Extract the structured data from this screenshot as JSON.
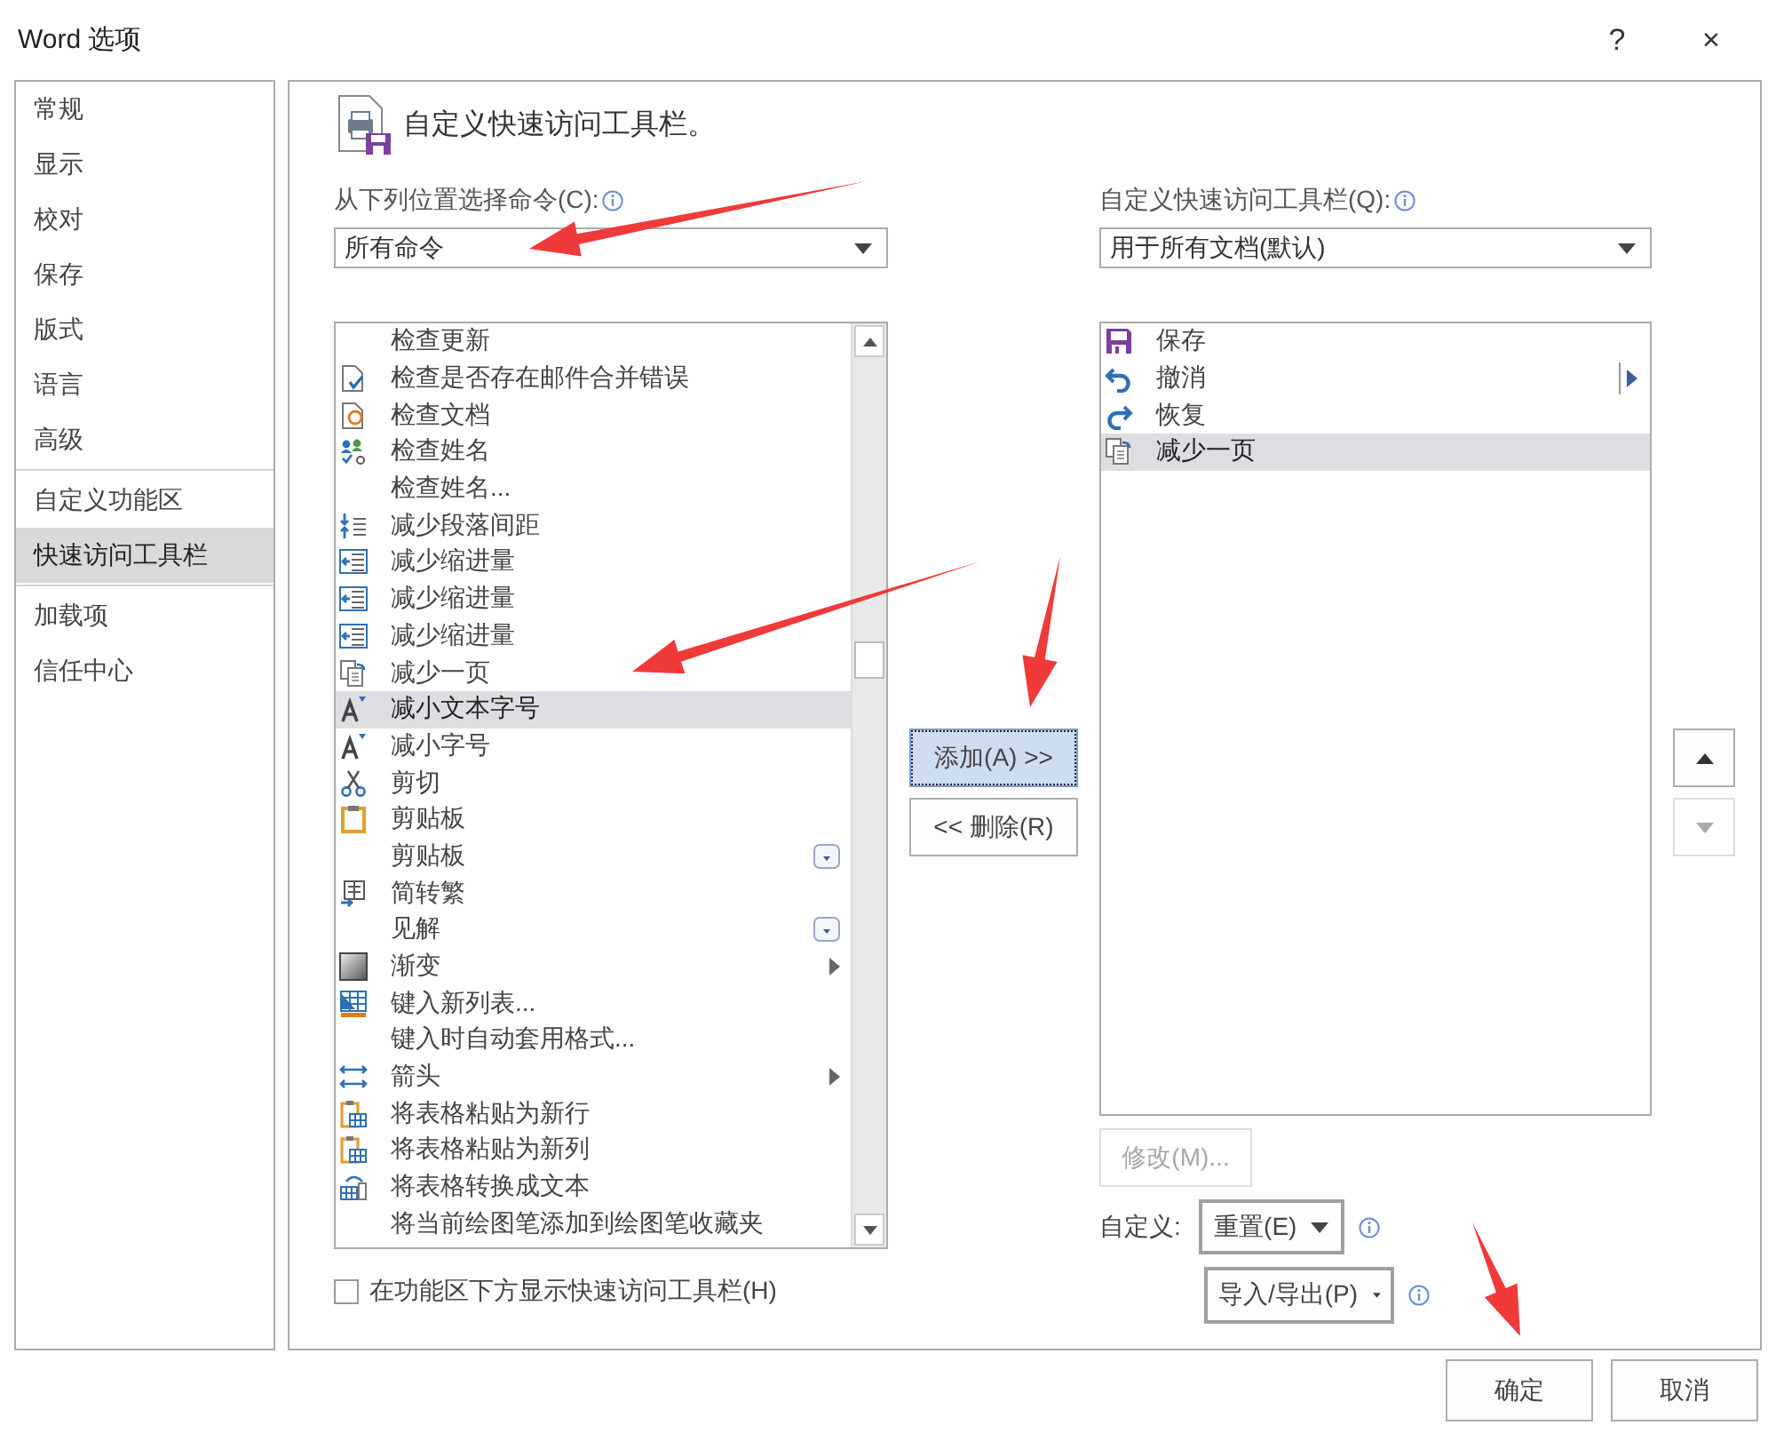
{
  "window": {
    "title": "Word 选项",
    "help": "?",
    "close": "×"
  },
  "sidebar": {
    "groups": [
      {
        "items": [
          {
            "label": "常规",
            "selected": false
          },
          {
            "label": "显示",
            "selected": false
          },
          {
            "label": "校对",
            "selected": false
          },
          {
            "label": "保存",
            "selected": false
          },
          {
            "label": "版式",
            "selected": false
          },
          {
            "label": "语言",
            "selected": false
          },
          {
            "label": "高级",
            "selected": false
          }
        ]
      },
      {
        "items": [
          {
            "label": "自定义功能区",
            "selected": false
          },
          {
            "label": "快速访问工具栏",
            "selected": true
          }
        ]
      },
      {
        "items": [
          {
            "label": "加载项",
            "selected": false
          },
          {
            "label": "信任中心",
            "selected": false
          }
        ]
      }
    ]
  },
  "panel": {
    "heading": "自定义快速访问工具栏。",
    "source": {
      "label": "从下列位置选择命令(C):",
      "value": "所有命令"
    },
    "commands": [
      {
        "label": "检查更新",
        "kind": "plain",
        "selected": false
      },
      {
        "label": "检查是否存在邮件合并错误",
        "kind": "plain",
        "selected": false
      },
      {
        "label": "检查文档",
        "kind": "plain",
        "selected": false
      },
      {
        "label": "检查姓名",
        "kind": "plain",
        "selected": false
      },
      {
        "label": "检查姓名...",
        "kind": "plain",
        "selected": false
      },
      {
        "label": "减少段落间距",
        "kind": "plain",
        "selected": false
      },
      {
        "label": "减少缩进量",
        "kind": "plain",
        "selected": false
      },
      {
        "label": "减少缩进量",
        "kind": "plain",
        "selected": false
      },
      {
        "label": "减少缩进量",
        "kind": "plain",
        "selected": false
      },
      {
        "label": "减少一页",
        "kind": "plain",
        "selected": false
      },
      {
        "label": "减小文本字号",
        "kind": "plain",
        "selected": true
      },
      {
        "label": "减小字号",
        "kind": "plain",
        "selected": false
      },
      {
        "label": "剪切",
        "kind": "plain",
        "selected": false
      },
      {
        "label": "剪贴板",
        "kind": "plain",
        "selected": false
      },
      {
        "label": "剪贴板",
        "kind": "gallery",
        "selected": false
      },
      {
        "label": "简转繁",
        "kind": "plain",
        "selected": false
      },
      {
        "label": "见解",
        "kind": "gallery",
        "selected": false
      },
      {
        "label": "渐变",
        "kind": "submenu",
        "selected": false
      },
      {
        "label": "键入新列表...",
        "kind": "plain",
        "selected": false
      },
      {
        "label": "键入时自动套用格式...",
        "kind": "plain",
        "selected": false
      },
      {
        "label": "箭头",
        "kind": "submenu",
        "selected": false
      },
      {
        "label": "将表格粘贴为新行",
        "kind": "plain",
        "selected": false
      },
      {
        "label": "将表格粘贴为新列",
        "kind": "plain",
        "selected": false
      },
      {
        "label": "将表格转换成文本",
        "kind": "plain",
        "selected": false
      },
      {
        "label": "将当前绘图笔添加到绘图笔收藏夹",
        "kind": "plain",
        "selected": false
      }
    ],
    "show_below": {
      "label": "在功能区下方显示快速访问工具栏(H)",
      "checked": false
    },
    "add_button": {
      "label": "添加(A) >>",
      "focused": true
    },
    "remove_button": {
      "label": "<< 删除(R)",
      "focused": false
    },
    "target": {
      "label": "自定义快速访问工具栏(Q):",
      "value": "用于所有文档(默认)"
    },
    "toolbar_items": [
      {
        "label": "保存",
        "kind": "plain",
        "selected": false
      },
      {
        "label": "撤消",
        "kind": "split",
        "selected": false
      },
      {
        "label": "恢复",
        "kind": "plain",
        "selected": false
      },
      {
        "label": "减少一页",
        "kind": "plain",
        "selected": true
      }
    ],
    "move_up": {
      "disabled": false
    },
    "move_down": {
      "disabled": true
    },
    "modify_button": {
      "label": "修改(M)...",
      "disabled": true
    },
    "customize_label": "自定义:",
    "reset_button": {
      "label": "重置(E)"
    },
    "import_export_button": {
      "label": "导入/导出(P)"
    }
  },
  "footer": {
    "ok": "确定",
    "cancel": "取消"
  },
  "annotations": [
    {
      "kind": "arrow"
    },
    {
      "kind": "arrow"
    },
    {
      "kind": "arrow"
    },
    {
      "kind": "arrow"
    }
  ]
}
